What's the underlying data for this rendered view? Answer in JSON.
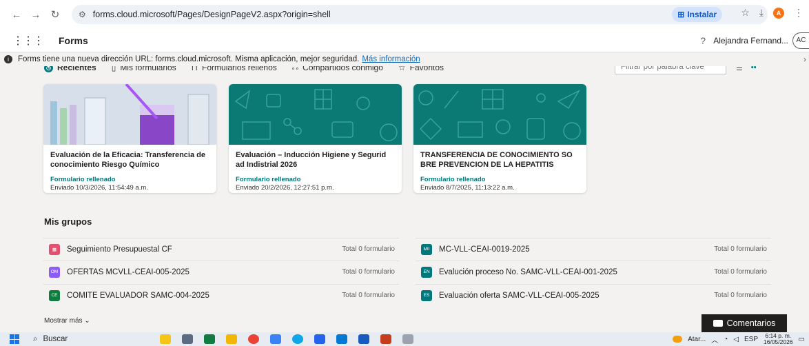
{
  "browser": {
    "url": "forms.cloud.microsoft/Pages/DesignPageV2.aspx?origin=shell",
    "install_label": "Instalar"
  },
  "header": {
    "app_name": "Forms",
    "help_glyph": "?",
    "user_name": "Alejandra Fernand...",
    "avatar_initials": "AC"
  },
  "infobar": {
    "message": "Forms tiene una nueva dirección URL: forms.cloud.microsoft. Misma aplicación, mejor seguridad.",
    "link": "Más información"
  },
  "tabs": [
    {
      "label": "Recientes",
      "icon": "clock-icon",
      "active": true
    },
    {
      "label": "Mis formularios",
      "icon": "document-icon",
      "active": false
    },
    {
      "label": "Formularios rellenos",
      "icon": "filled-form-icon",
      "active": false
    },
    {
      "label": "Compartidos conmigo",
      "icon": "people-icon",
      "active": false
    },
    {
      "label": "Favoritos",
      "icon": "star-icon",
      "active": false
    }
  ],
  "filter": {
    "placeholder": "Filtrar por palabra clave"
  },
  "cards": [
    {
      "title": "Evaluación de la Eficacia: Transferencia de conocimiento Riesgo Químico",
      "status": "Formulario rellenado",
      "date": "Enviado 10/3/2026, 11:54:49 a.m.",
      "thumb": "photo"
    },
    {
      "title": "Evaluación – Inducción Higiene y Segurid ad Indistrial 2026",
      "status": "Formulario rellenado",
      "date": "Enviado 20/2/2026, 12:27:51 p.m.",
      "thumb": "teal"
    },
    {
      "title": "TRANSFERENCIA DE CONOCIMIENTO SO BRE PREVENCION DE LA HEPATITIS",
      "status": "Formulario rellenado",
      "date": "Enviado 8/7/2025, 11:13:22 a.m.",
      "thumb": "teal"
    }
  ],
  "groups_title": "Mis grupos",
  "groups": [
    {
      "badge": "",
      "name": "Seguimiento Presupuestal CF",
      "count": "Total 0 formulario",
      "color": "#e05270"
    },
    {
      "badge": "MII",
      "name": "MC-VLL-CEAI-0019-2025",
      "count": "Total 0 formulario",
      "color": "#03787c"
    },
    {
      "badge": "OM",
      "name": "OFERTAS MCVLL-CEAI-005-2025",
      "count": "Total 0 formulario",
      "color": "#8b5cf6"
    },
    {
      "badge": "EN",
      "name": "Evalución proceso No. SAMC-VLL-CEAI-001-2025",
      "count": "Total 0 formulario",
      "color": "#03787c"
    },
    {
      "badge": "CE",
      "name": "COMITE EVALUADOR SAMC-004-2025",
      "count": "Total 0 formulario",
      "color": "#107c41"
    },
    {
      "badge": "ES",
      "name": "Evaluación oferta SAMC-VLL-CEAI-005-2025",
      "count": "Total 0 formulario",
      "color": "#03787c"
    }
  ],
  "show_more": "Mostrar más",
  "comments_label": "Comentarios",
  "taskbar": {
    "search_label": "Buscar",
    "weather": "Atar...",
    "lang": "ESP",
    "time": "6:14 p. m.",
    "date": "16/05/2026"
  },
  "colors": {
    "accent": "#03787c",
    "link": "#0f6cbd",
    "card_teal": "#0b7a75"
  }
}
